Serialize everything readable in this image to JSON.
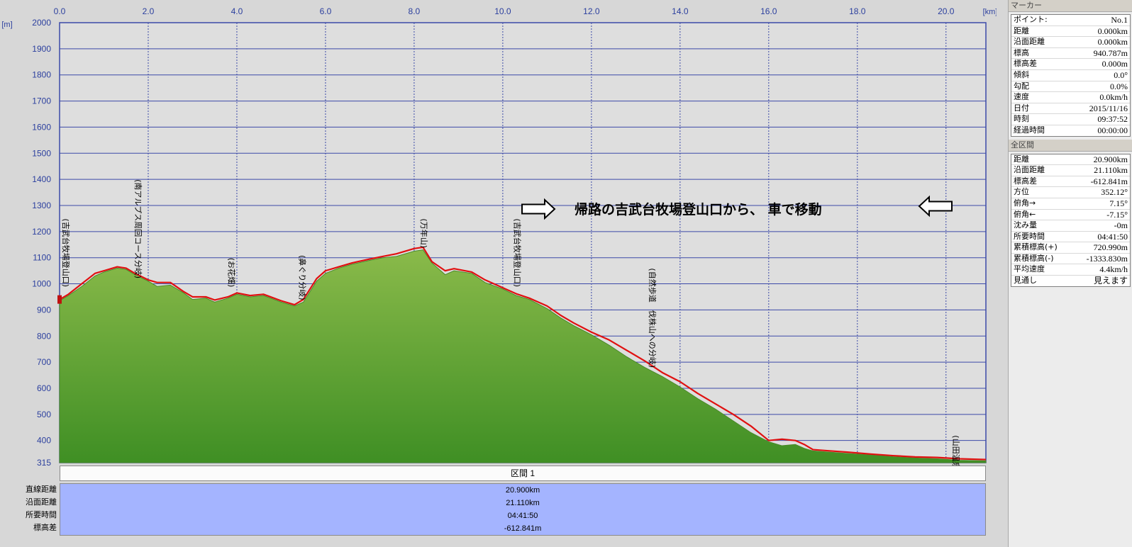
{
  "chart_data": {
    "type": "area",
    "x_unit": "[km]",
    "y_unit": "[m]",
    "xlim": [
      0,
      20.9
    ],
    "ylim": [
      315,
      2000
    ],
    "x_ticks": [
      "0.0",
      "2.0",
      "4.0",
      "6.0",
      "8.0",
      "10.0",
      "12.0",
      "14.0",
      "16.0",
      "18.0",
      "20.0"
    ],
    "y_ticks": [
      "2000",
      "1900",
      "1800",
      "1700",
      "1600",
      "1500",
      "1400",
      "1300",
      "1200",
      "1100",
      "1000",
      "900",
      "800",
      "700",
      "600",
      "500",
      "400",
      "315"
    ],
    "profile": {
      "x": [
        0,
        0.2,
        0.5,
        0.8,
        1.0,
        1.3,
        1.5,
        1.7,
        2.0,
        2.2,
        2.5,
        2.8,
        3.0,
        3.3,
        3.5,
        3.8,
        4.0,
        4.3,
        4.6,
        5.0,
        5.3,
        5.5,
        5.8,
        6.0,
        6.3,
        6.6,
        7.0,
        7.3,
        7.6,
        8.0,
        8.2,
        8.4,
        8.7,
        8.9,
        9.3,
        9.6,
        10.0,
        10.3,
        10.6,
        11.0,
        11.3,
        11.6,
        12.0,
        12.4,
        12.8,
        13.2,
        13.6,
        14.0,
        14.4,
        14.8,
        15.2,
        15.6,
        16.0,
        16.3,
        16.6,
        16.8,
        17.0,
        17.4,
        17.8,
        18.3,
        18.8,
        19.3,
        19.8,
        20.3,
        20.9
      ],
      "y": [
        935,
        955,
        990,
        1030,
        1045,
        1060,
        1055,
        1035,
        1010,
        990,
        995,
        965,
        940,
        945,
        930,
        945,
        960,
        950,
        955,
        930,
        915,
        930,
        1010,
        1040,
        1060,
        1075,
        1090,
        1100,
        1105,
        1125,
        1130,
        1080,
        1035,
        1050,
        1040,
        1005,
        980,
        955,
        940,
        905,
        870,
        840,
        805,
        765,
        720,
        680,
        645,
        605,
        560,
        520,
        475,
        430,
        395,
        380,
        385,
        370,
        360,
        355,
        350,
        345,
        338,
        333,
        330,
        324,
        322
      ]
    },
    "track": {
      "x": [
        0,
        0.2,
        0.5,
        0.8,
        1.0,
        1.3,
        1.5,
        1.7,
        2.0,
        2.2,
        2.5,
        2.8,
        3.0,
        3.3,
        3.5,
        3.8,
        4.0,
        4.3,
        4.6,
        5.0,
        5.3,
        5.5,
        5.8,
        6.0,
        6.3,
        6.6,
        7.0,
        7.3,
        7.6,
        8.0,
        8.2,
        8.4,
        8.7,
        8.9,
        9.3,
        9.6,
        10.0,
        10.3,
        10.6,
        11.0,
        11.3,
        11.6,
        12.0,
        12.4,
        12.8,
        13.2,
        13.6,
        14.0,
        14.4,
        14.8,
        15.2,
        15.6,
        16.0,
        16.3,
        16.6,
        16.8,
        17.0,
        17.4,
        17.8,
        18.3,
        18.8,
        19.3,
        19.8,
        20.3,
        20.9
      ],
      "y": [
        940,
        960,
        1000,
        1040,
        1050,
        1065,
        1060,
        1040,
        1015,
        1005,
        1005,
        970,
        950,
        950,
        938,
        950,
        965,
        955,
        960,
        935,
        920,
        940,
        1020,
        1050,
        1065,
        1080,
        1095,
        1105,
        1115,
        1135,
        1140,
        1085,
        1050,
        1058,
        1045,
        1015,
        985,
        962,
        945,
        915,
        880,
        850,
        815,
        785,
        745,
        705,
        660,
        625,
        580,
        540,
        500,
        455,
        400,
        405,
        400,
        385,
        365,
        360,
        355,
        348,
        342,
        337,
        335,
        330,
        327
      ]
    },
    "waypoints": [
      {
        "x": 0.02,
        "label": "(吉武台牧場登山口)"
      },
      {
        "x": 1.65,
        "label": "(南アルプス周回コース分岐)"
      },
      {
        "x": 3.75,
        "label": "(お花畑)"
      },
      {
        "x": 5.35,
        "label": "(鼻ぐり分岐)"
      },
      {
        "x": 8.1,
        "label": "(万年山)"
      },
      {
        "x": 10.2,
        "label": "(吉武台牧場登山口)"
      },
      {
        "x": 13.25,
        "label": "(自然歩道　伐株山への分岐)"
      },
      {
        "x": 20.1,
        "label": "(山田温泉)"
      }
    ],
    "annotation": "帰路の吉武台牧場登山口から、 車で移動",
    "area_color": "#5aa02a",
    "track_color": "#e01010",
    "grid_color": "#3c4aa8",
    "background": "#dedede",
    "grid": true
  },
  "section": {
    "title": "区間 1",
    "rows": [
      {
        "label": "直線距離",
        "value": "20.900km"
      },
      {
        "label": "沿面距離",
        "value": "21.110km"
      },
      {
        "label": "所要時間",
        "value": "04:41:50"
      },
      {
        "label": "標高差",
        "value": "-612.841m"
      }
    ]
  },
  "marker": {
    "title": "マーカー",
    "rows": [
      {
        "k": "ポイント:",
        "v": "No.1"
      },
      {
        "k": "距離",
        "v": "0.000km"
      },
      {
        "k": "沿面距離",
        "v": "0.000km"
      },
      {
        "k": "標高",
        "v": "940.787m"
      },
      {
        "k": "標高差",
        "v": "0.000m"
      },
      {
        "k": "傾斜",
        "v": "0.0°"
      },
      {
        "k": "勾配",
        "v": "0.0%"
      },
      {
        "k": "速度",
        "v": "0.0km/h"
      },
      {
        "k": "日付",
        "v": "2015/11/16"
      },
      {
        "k": "時刻",
        "v": "09:37:52"
      },
      {
        "k": "経過時間",
        "v": "00:00:00"
      }
    ]
  },
  "total": {
    "title": "全区間",
    "rows": [
      {
        "k": "距離",
        "v": "20.900km"
      },
      {
        "k": "沿面距離",
        "v": "21.110km"
      },
      {
        "k": "標高差",
        "v": "-612.841m"
      },
      {
        "k": "方位",
        "v": "352.12°"
      },
      {
        "k": "俯角→",
        "v": "7.15°"
      },
      {
        "k": "俯角←",
        "v": "-7.15°"
      },
      {
        "k": "沈み量",
        "v": "-0m"
      },
      {
        "k": "所要時間",
        "v": "04:41:50"
      },
      {
        "k": "累積標高(+)",
        "v": "720.990m"
      },
      {
        "k": "累積標高(-)",
        "v": "-1333.830m"
      },
      {
        "k": "平均速度",
        "v": "4.4km/h"
      },
      {
        "k": "見通し",
        "v": "見えます"
      }
    ]
  }
}
